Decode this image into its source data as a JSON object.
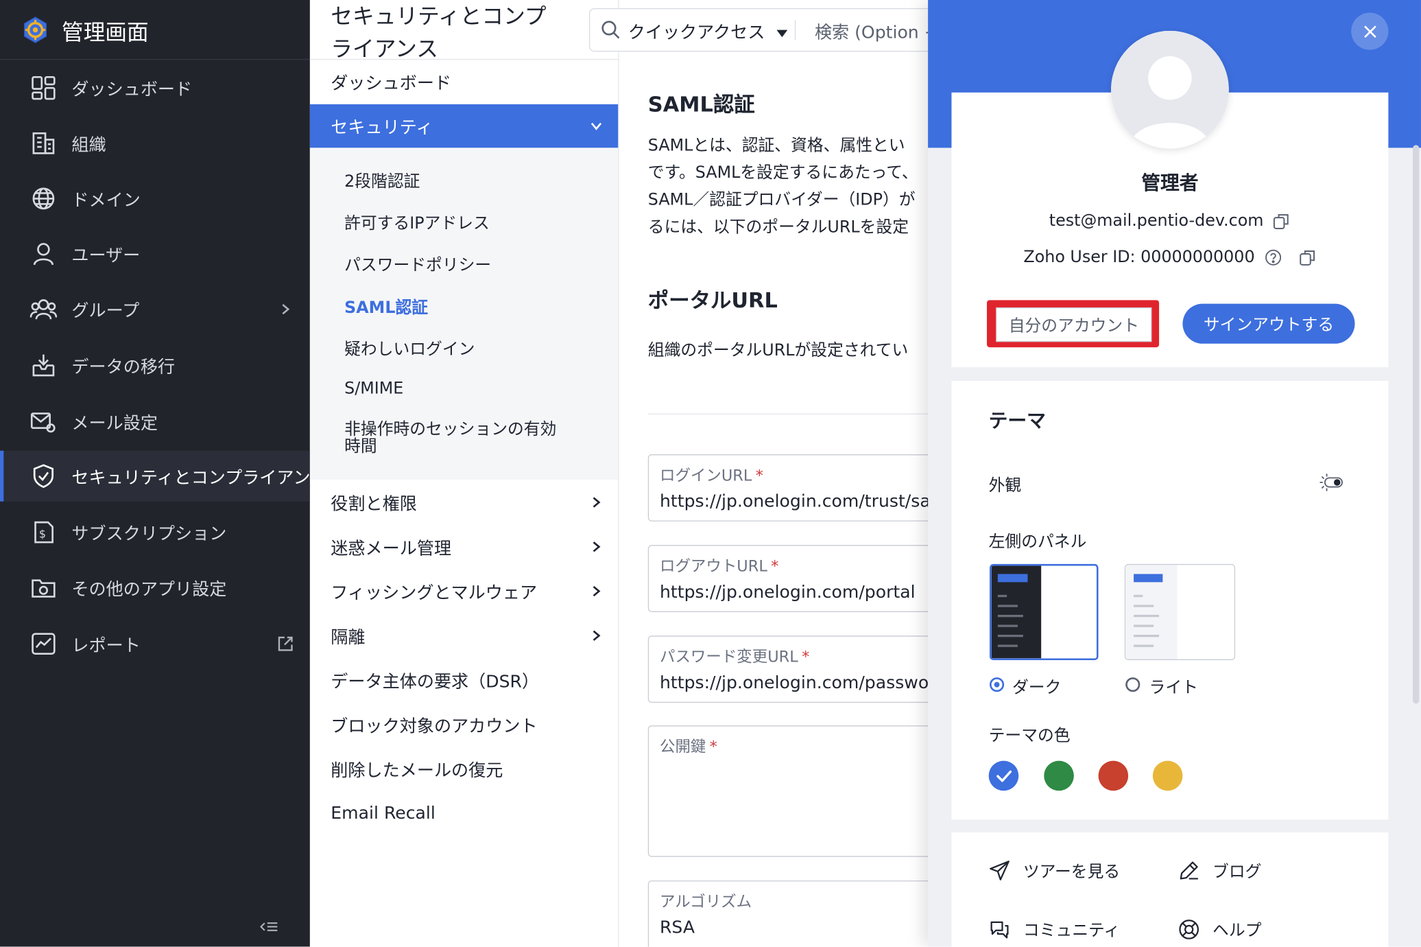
{
  "sidebar": {
    "title": "管理画面",
    "items": [
      {
        "label": "ダッシュボード"
      },
      {
        "label": "組織"
      },
      {
        "label": "ドメイン"
      },
      {
        "label": "ユーザー"
      },
      {
        "label": "グループ"
      },
      {
        "label": "データの移行"
      },
      {
        "label": "メール設定"
      },
      {
        "label": "セキュリティとコンプライアンス"
      },
      {
        "label": "サブスクリプション"
      },
      {
        "label": "その他のアプリ設定"
      },
      {
        "label": "レポート"
      }
    ],
    "active_index": 7
  },
  "page": {
    "title_line1": "セキュリティとコンプ",
    "title_line2": "ライアンス"
  },
  "search": {
    "quick_access": "クイックアクセス",
    "search_placeholder": "検索 (Option +"
  },
  "submenu": {
    "dashboard": "ダッシュボード",
    "security": "セキュリティ",
    "security_items": [
      "2段階認証",
      "許可するIPアドレス",
      "パスワードポリシー",
      "SAML認証",
      "疑わしいログイン",
      "S/MIME",
      "非操作時のセッションの有効",
      "時間"
    ],
    "current_index": 3,
    "others": [
      {
        "label": "役割と権限",
        "chevron": true
      },
      {
        "label": "迷惑メール管理",
        "chevron": true
      },
      {
        "label": "フィッシングとマルウェア",
        "chevron": true
      },
      {
        "label": "隔離",
        "chevron": true
      },
      {
        "label": "データ主体の要求（DSR）",
        "chevron": false
      },
      {
        "label": "ブロック対象のアカウント",
        "chevron": false
      },
      {
        "label": "削除したメールの復元",
        "chevron": false
      },
      {
        "label": "Email Recall",
        "chevron": false
      }
    ]
  },
  "content": {
    "saml_heading": "SAML認証",
    "saml_desc": [
      "SAMLとは、認証、資格、属性とい",
      "です。SAMLを設定するにあたって、",
      "SAML／認証プロバイダー（IDP）が",
      "るには、以下のポータルURLを設定"
    ],
    "portal_heading": "ポータルURL",
    "portal_desc": "組織のポータルURLが設定されてい",
    "fields": [
      {
        "label": "ログインURL",
        "value": "https://jp.onelogin.com/trust/saml"
      },
      {
        "label": "ログアウトURL",
        "value": "https://jp.onelogin.com/portal"
      },
      {
        "label": "パスワード変更URL",
        "value": "https://jp.onelogin.com/password"
      },
      {
        "label": "公開鍵",
        "value": ""
      },
      {
        "label": "アルゴリズム",
        "value": "RSA"
      }
    ],
    "required_mark": "*"
  },
  "profile": {
    "name": "管理者",
    "email": "test@mail.pentio-dev.com",
    "user_id": "Zoho User ID: 00000000000",
    "account_button": "自分のアカウント",
    "signout_button": "サインアウトする",
    "theme_heading": "テーマ",
    "appearance_label": "外観",
    "left_panel_label": "左側のパネル",
    "dark_label": "ダーク",
    "light_label": "ライト",
    "theme_color_label": "テーマの色",
    "colors": [
      "#3d6fde",
      "#2e8a44",
      "#c8402e",
      "#e8b73a"
    ],
    "selected_color_index": 0,
    "links": {
      "tour": "ツアーを見る",
      "blog": "ブログ",
      "community": "コミュニティ",
      "help": "ヘルプ"
    }
  },
  "colors": {
    "accent": "#3d6fde",
    "sidebar_bg": "#22242b",
    "highlight": "#e0242e"
  }
}
